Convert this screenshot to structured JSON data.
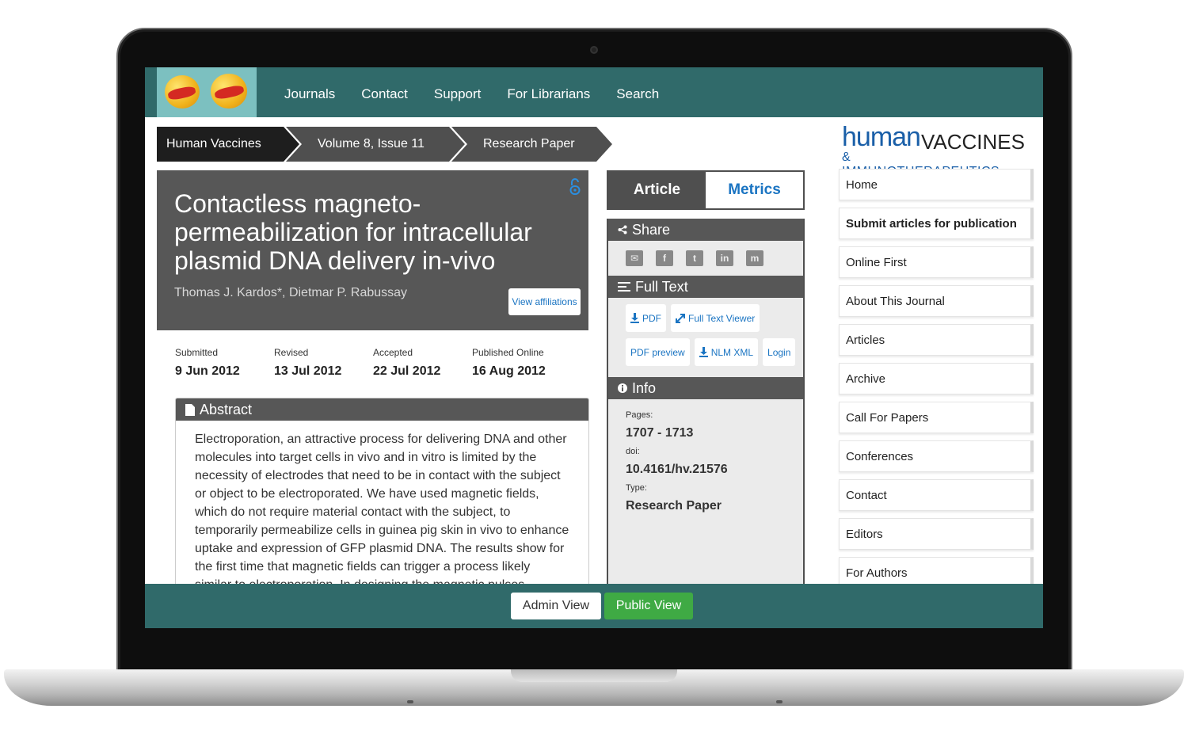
{
  "nav": {
    "links": [
      "Journals",
      "Contact",
      "Support",
      "For Librarians",
      "Search"
    ]
  },
  "breadcrumb": [
    "Human Vaccines",
    "Volume 8, Issue 11",
    "Research Paper"
  ],
  "article": {
    "title": "Contactless magneto-permeabilization for intracellular plasmid DNA delivery in-vivo",
    "authors": "Thomas J. Kardos*, Dietmar P. Rabussay",
    "affiliations_button": "View affiliations",
    "dates": [
      {
        "label": "Submitted",
        "value": "9 Jun 2012"
      },
      {
        "label": "Revised",
        "value": "13 Jul 2012"
      },
      {
        "label": "Accepted",
        "value": "22 Jul 2012"
      },
      {
        "label": "Published Online",
        "value": "16 Aug 2012"
      }
    ],
    "abstract_heading": "Abstract",
    "abstract": "Electroporation, an attractive process for delivering DNA and other molecules into target cells in vivo and in vitro is limited by the necessity of electrodes that need to be in contact with the subject or object to be electroporated. We have used magnetic fields, which do not require material contact with the subject, to temporarily permeabilize cells in guinea pig skin in vivo to enhance uptake and expression of GFP plasmid DNA. The results show for the first time that magnetic fields can trigger a process likely similar to electroporation. In designing the magnetic pulses"
  },
  "tabs": {
    "article": "Article",
    "metrics": "Metrics"
  },
  "share": {
    "heading": "Share",
    "icons": [
      "email-icon",
      "facebook-icon",
      "twitter-icon",
      "linkedin-icon",
      "mendeley-icon"
    ]
  },
  "fulltext": {
    "heading": "Full Text",
    "buttons": [
      "PDF",
      "Full Text Viewer",
      "PDF preview",
      "NLM XML",
      "Login"
    ]
  },
  "info": {
    "heading": "Info",
    "pages_label": "Pages:",
    "pages": "1707 - 1713",
    "doi_label": "doi:",
    "doi": "10.4161/hv.21576",
    "type_label": "Type:",
    "type": "Research Paper"
  },
  "brand": {
    "human": "human",
    "vaccines": "VACCINES",
    "sub": "& IMMUNOTHERAPEUTICS"
  },
  "sidebar": [
    "Home",
    "Submit articles for publication",
    "Online First",
    "About This Journal",
    "Articles",
    "Archive",
    "Call For Papers",
    "Conferences",
    "Contact",
    "Editors",
    "For Authors"
  ],
  "footer": {
    "admin": "Admin View",
    "public": "Public View"
  },
  "colors": {
    "nav_bg": "#306a6a",
    "link": "#1a74c2",
    "public_btn": "#3faa44"
  }
}
